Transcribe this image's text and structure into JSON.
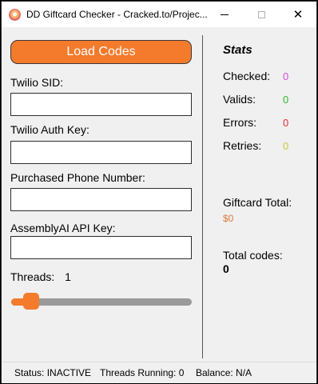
{
  "window": {
    "title": "DD Giftcard Checker - Cracked.to/Projec...",
    "controls": {
      "minimize": "—",
      "maximize": "☐",
      "close": "✕"
    }
  },
  "left": {
    "load_button": "Load Codes",
    "fields": [
      {
        "label": "Twilio SID:",
        "value": ""
      },
      {
        "label": "Twilio Auth Key:",
        "value": ""
      },
      {
        "label": "Purchased Phone Number:",
        "value": ""
      },
      {
        "label": "AssemblyAI API Key:",
        "value": ""
      }
    ],
    "threads": {
      "label": "Threads:",
      "value": "1",
      "slider_fraction": 0.07
    }
  },
  "stats": {
    "title": "Stats",
    "items": [
      {
        "label": "Checked:",
        "value": "0",
        "color": "#d14cd6"
      },
      {
        "label": "Valids:",
        "value": "0",
        "color": "#2fb82f"
      },
      {
        "label": "Errors:",
        "value": "0",
        "color": "#e03030"
      },
      {
        "label": "Retries:",
        "value": "0",
        "color": "#c8c840"
      }
    ],
    "giftcard_total": {
      "label": "Giftcard Total:",
      "value": "$0"
    },
    "total_codes": {
      "label": "Total codes:",
      "value": "0"
    }
  },
  "status": {
    "status": "Status: INACTIVE",
    "threads_running": "Threads Running: 0",
    "balance": "Balance: N/A"
  },
  "colors": {
    "accent": "#f47a2c",
    "slider_track": "#9a9a9a"
  }
}
